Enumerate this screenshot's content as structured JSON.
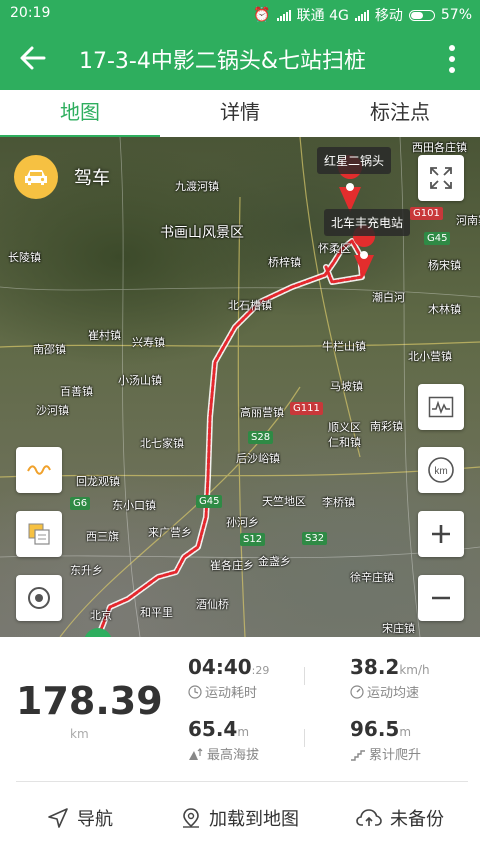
{
  "status_bar": {
    "time": "20:19",
    "carrier1": "联通 4G",
    "carrier2": "移动",
    "battery": "57%"
  },
  "app_bar": {
    "title": "17-3-4中影二锅头&七站扫桩"
  },
  "tabs": [
    {
      "label": "地图",
      "active": true
    },
    {
      "label": "详情",
      "active": false
    },
    {
      "label": "标注点",
      "active": false
    }
  ],
  "map": {
    "mode_label": "驾车",
    "start_marker_label": "红星二锅头",
    "end_marker_label": "北车丰充电站",
    "place_labels": [
      "九渡河镇",
      "书画山风景区",
      "长陵镇",
      "桥梓镇",
      "怀柔区",
      "北石槽镇",
      "崔村镇",
      "兴寿镇",
      "南邵镇",
      "百善镇",
      "小汤山镇",
      "沙河镇",
      "高丽营镇",
      "牛栏山镇",
      "马坡镇",
      "北小营镇",
      "木林镇",
      "北七家镇",
      "后沙峪镇",
      "南彩镇",
      "仁和镇",
      "顺义区",
      "回龙观镇",
      "东小口镇",
      "天竺地区",
      "李桥镇",
      "来广营乡",
      "孙河乡",
      "西三旗",
      "东升乡",
      "崔各庄乡",
      "金盏乡",
      "北京",
      "和平里",
      "酒仙桥",
      "徐辛庄镇",
      "宋庄镇",
      "杨宋镇",
      "西田各庄镇",
      "潮白河",
      "河南寨镇"
    ],
    "road_shields": [
      "G101",
      "G45",
      "G111",
      "S28",
      "G45",
      "S12",
      "S32",
      "G6"
    ],
    "controls": [
      "wave-icon",
      "layers-icon",
      "locate-icon",
      "compass-icon",
      "chart-icon",
      "km-icon",
      "zoom-in-icon",
      "zoom-out-icon"
    ],
    "route_color": "#e3282e"
  },
  "stats": {
    "distance": {
      "value": "178.39",
      "unit": "km"
    },
    "duration": {
      "value": "04:40",
      "seconds": ":29",
      "label": "运动耗时"
    },
    "avg_speed": {
      "value": "38.2",
      "unit": "km/h",
      "label": "运动均速"
    },
    "max_alt": {
      "value": "65.4",
      "unit": "m",
      "label": "最高海拔"
    },
    "climb": {
      "value": "96.5",
      "unit": "m",
      "label": "累计爬升"
    }
  },
  "actions": [
    {
      "label": "导航"
    },
    {
      "label": "加载到地图"
    },
    {
      "label": "未备份"
    }
  ],
  "colors": {
    "primary": "#2eae5e",
    "driving_badge": "#f6c142"
  }
}
